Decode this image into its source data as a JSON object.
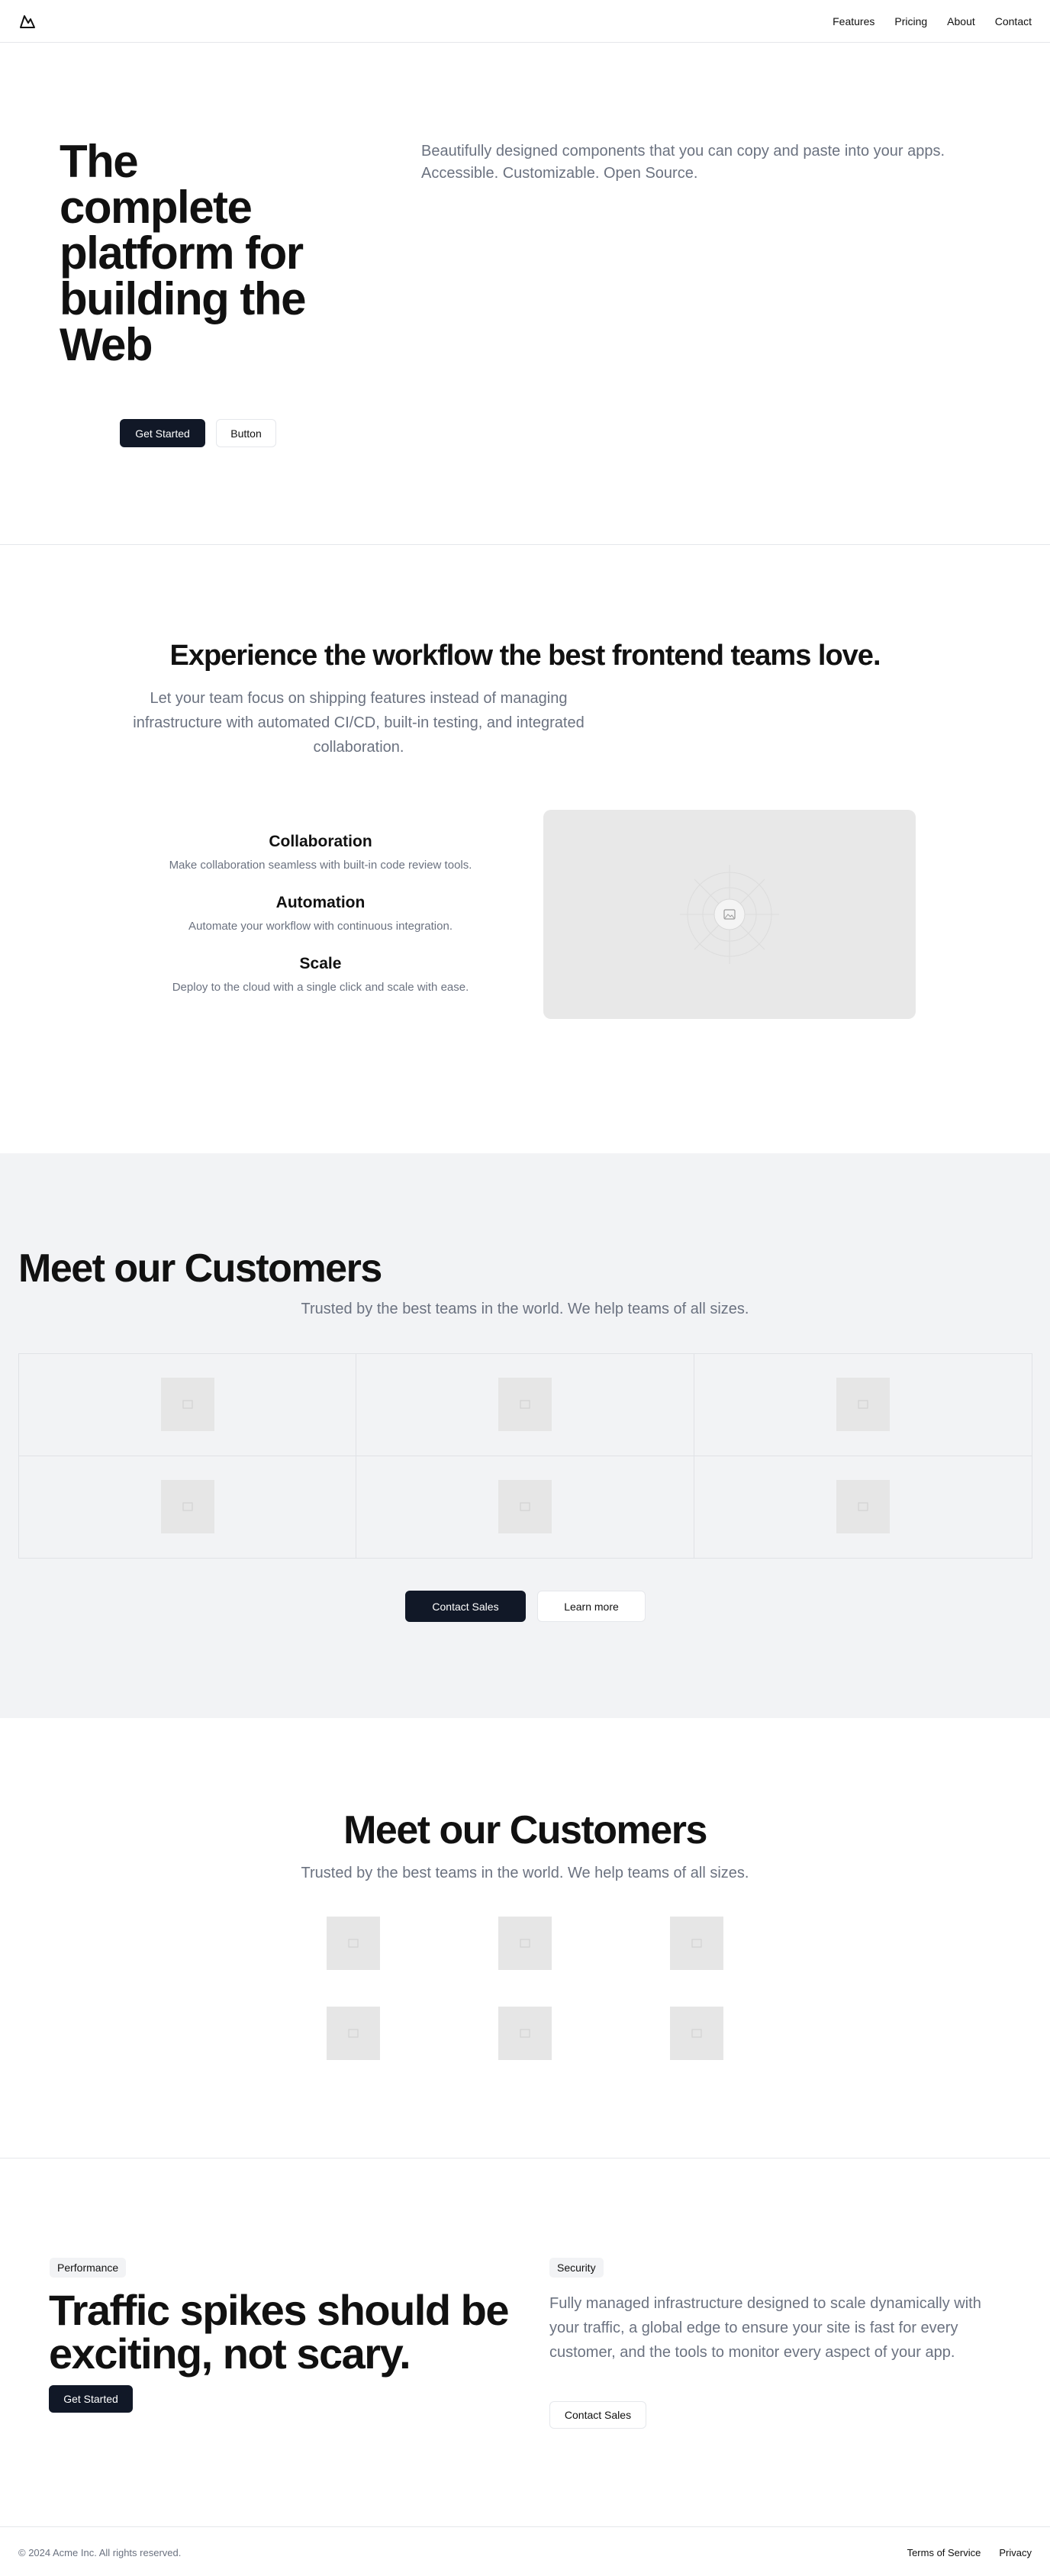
{
  "header": {
    "logo_icon": "mountain-logo-icon",
    "nav": [
      "Features",
      "Pricing",
      "About",
      "Contact"
    ]
  },
  "hero": {
    "title": "The complete platform for building the Web",
    "description": "Beautifully designed components that you can copy and paste into your apps. Accessible. Customizable. Open Source.",
    "primary_button": "Get Started",
    "secondary_button": "Button"
  },
  "workflow": {
    "title": "Experience the workflow the best frontend teams love.",
    "description": "Let your team focus on shipping features instead of managing infrastructure with automated CI/CD, built-in testing, and integrated collaboration.",
    "features": [
      {
        "title": "Collaboration",
        "text": "Make collaboration seamless with built-in code review tools."
      },
      {
        "title": "Automation",
        "text": "Automate your workflow with continuous integration."
      },
      {
        "title": "Scale",
        "text": "Deploy to the cloud with a single click and scale with ease."
      }
    ],
    "image_icon": "image-placeholder-icon"
  },
  "customers": {
    "title": "Meet our Customers",
    "subtitle": "Trusted by the best teams in the world. We help teams of all sizes.",
    "primary_button": "Contact Sales",
    "secondary_button": "Learn more"
  },
  "customers2": {
    "title": "Meet our Customers",
    "subtitle": "Trusted by the best teams in the world. We help teams of all sizes."
  },
  "performance": {
    "badge": "Performance",
    "title": "Traffic spikes should be exciting, not scary.",
    "button": "Get Started"
  },
  "security": {
    "badge": "Security",
    "description": "Fully managed infrastructure designed to scale dynamically with your traffic, a global edge to ensure your site is fast for every customer, and the tools to monitor every aspect of your app.",
    "button": "Contact Sales"
  },
  "footer": {
    "copyright": "© 2024 Acme Inc. All rights reserved.",
    "links": [
      "Terms of Service",
      "Privacy"
    ]
  },
  "colors": {
    "primary": "#111827",
    "muted_text": "#6b7280",
    "section_bg": "#f2f3f5"
  }
}
